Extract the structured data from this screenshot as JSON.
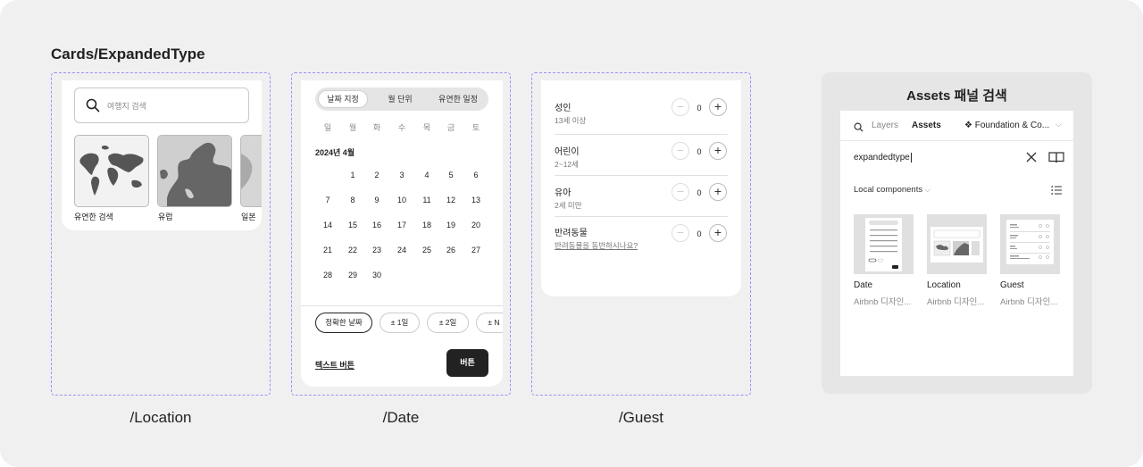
{
  "section_title": "Cards/ExpandedType",
  "colors": {
    "accent_dashed": "#a78bfa",
    "primary_button": "#222222",
    "canvas": "#f0f0f0"
  },
  "location": {
    "label": "/Location",
    "search_placeholder": "여행지 검색",
    "regions": [
      "유연한 검색",
      "유럽",
      "일본"
    ]
  },
  "date": {
    "label": "/Date",
    "tabs": [
      "날짜 지정",
      "월 단위",
      "유연한 일정"
    ],
    "weekdays": [
      "일",
      "월",
      "화",
      "수",
      "목",
      "금",
      "토"
    ],
    "month": "2024년 4월",
    "days": [
      "1",
      "2",
      "3",
      "4",
      "5",
      "6",
      "7",
      "8",
      "9",
      "10",
      "11",
      "12",
      "13",
      "14",
      "15",
      "16",
      "17",
      "18",
      "19",
      "20",
      "21",
      "22",
      "23",
      "24",
      "25",
      "26",
      "27",
      "28",
      "29",
      "30"
    ],
    "chips": [
      "정확한 날짜",
      "± 1일",
      "± 2일",
      "± N"
    ],
    "text_button": "텍스트 버튼",
    "solid_button": "버튼"
  },
  "guest": {
    "label": "/Guest",
    "rows": [
      {
        "title": "성인",
        "subtitle": "13세 이상",
        "count": "0"
      },
      {
        "title": "어린이",
        "subtitle": "2~12세",
        "count": "0"
      },
      {
        "title": "유아",
        "subtitle": "2세 미만",
        "count": "0"
      },
      {
        "title": "반려동물",
        "subtitle": "반려동물을 동반하시나요?",
        "count": "0"
      }
    ]
  },
  "assets_panel": {
    "heading": "Assets 패널 검색",
    "tabs": {
      "layers": "Layers",
      "assets": "Assets",
      "library": "❖ Foundation & Co..."
    },
    "search_value": "expandedtype",
    "section": "Local components",
    "components": [
      {
        "name": "Date",
        "desc": "Airbnb 디자인..."
      },
      {
        "name": "Location",
        "desc": "Airbnb 디자인..."
      },
      {
        "name": "Guest",
        "desc": "Airbnb 디자인..."
      }
    ]
  }
}
